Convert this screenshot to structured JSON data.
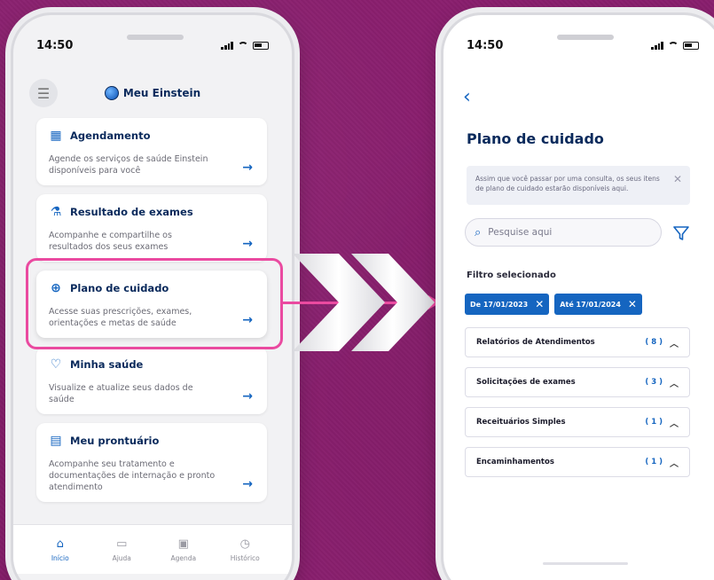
{
  "left_phone": {
    "status_time": "14:50",
    "brand": "Meu Einstein",
    "cards": [
      {
        "title": "Agendamento",
        "desc": "Agende os serviços de saúde Einstein disponíveis para você",
        "icon": "calendar-icon"
      },
      {
        "title": "Resultado de exames",
        "desc": "Acompanhe e compartilhe os resultados dos seus exames",
        "icon": "test-tube-icon"
      },
      {
        "title": "Plano de cuidado",
        "desc": "Acesse suas prescrições, exames, orientações e metas de saúde",
        "icon": "care-plan-icon"
      },
      {
        "title": "Minha saúde",
        "desc": "Visualize e atualize seus dados de saúde",
        "icon": "heart-icon"
      },
      {
        "title": "Meu prontuário",
        "desc": "Acompanhe seu tratamento e documentações de internação e pronto atendimento",
        "icon": "medical-record-icon"
      }
    ],
    "nav": [
      {
        "label": "Início",
        "icon": "home-icon"
      },
      {
        "label": "Ajuda",
        "icon": "chat-icon"
      },
      {
        "label": "Agenda",
        "icon": "calendar-icon"
      },
      {
        "label": "Histórico",
        "icon": "clock-icon"
      }
    ]
  },
  "right_phone": {
    "status_time": "14:50",
    "title": "Plano de cuidado",
    "info": "Assim que você passar por uma consulta, os seus itens de plano de cuidado estarão disponíveis aqui.",
    "search_placeholder": "Pesquise aqui",
    "filter_label": "Filtro selecionado",
    "chips": [
      "De 17/01/2023",
      "Até 17/01/2024"
    ],
    "sections": [
      {
        "label": "Relatórios de Atendimentos",
        "count": "( 8 )"
      },
      {
        "label": "Solicitações de exames",
        "count": "( 3 )"
      },
      {
        "label": "Receituários Simples",
        "count": "( 1 )"
      },
      {
        "label": "Encaminhamentos",
        "count": "( 1 )"
      }
    ]
  },
  "colors": {
    "accent": "#1565c0",
    "highlight": "#ea4aa0",
    "background": "#8a1f6e"
  }
}
